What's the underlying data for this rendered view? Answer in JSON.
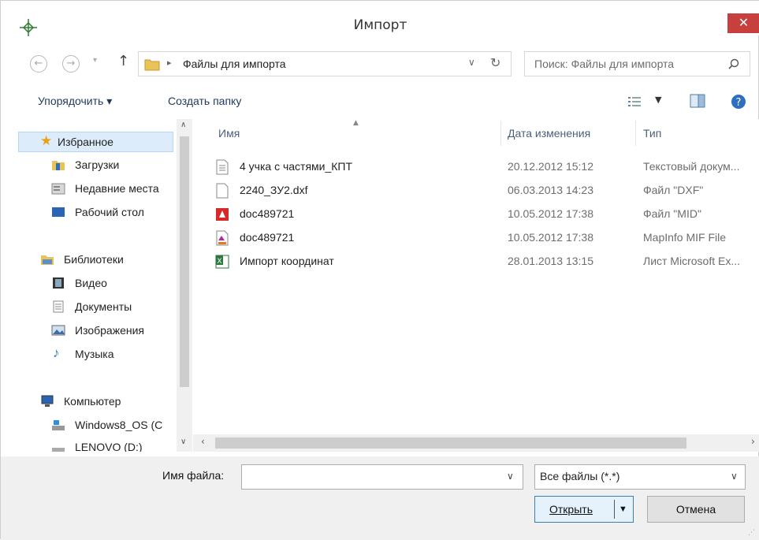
{
  "window": {
    "title": "Импорт",
    "close_glyph": "✕"
  },
  "address": {
    "separator": "▸",
    "folder": "Файлы для импорта"
  },
  "search": {
    "placeholder": "Поиск: Файлы для импорта"
  },
  "toolbar": {
    "organize": "Упорядочить ▾",
    "new_folder": "Создать папку"
  },
  "columns": {
    "name": "Имя",
    "date": "Дата изменения",
    "type": "Тип"
  },
  "sidebar": {
    "items": [
      {
        "label": "Избранное",
        "icon": "star-icon",
        "group": true
      },
      {
        "label": "Загрузки",
        "icon": "downloads-folder-icon"
      },
      {
        "label": "Недавние места",
        "icon": "recent-places-icon"
      },
      {
        "label": "Рабочий стол",
        "icon": "desktop-icon"
      },
      {
        "label": "Библиотеки",
        "icon": "libraries-icon",
        "group": true
      },
      {
        "label": "Видео",
        "icon": "video-icon"
      },
      {
        "label": "Документы",
        "icon": "documents-icon"
      },
      {
        "label": "Изображения",
        "icon": "pictures-icon"
      },
      {
        "label": "Музыка",
        "icon": "music-icon"
      },
      {
        "label": "Компьютер",
        "icon": "computer-icon",
        "group": true
      },
      {
        "label": "Windows8_OS (C",
        "icon": "drive-c-icon"
      },
      {
        "label": "LENOVO (D:)",
        "icon": "drive-d-icon"
      }
    ]
  },
  "files": [
    {
      "name": "4 учка с частями_КПТ",
      "date": "20.12.2012 15:12",
      "type": "Текстовый докум...",
      "icon": "text-file-icon"
    },
    {
      "name": "2240_ЗУ2.dxf",
      "date": "06.03.2013 14:23",
      "type": "Файл \"DXF\"",
      "icon": "blank-file-icon"
    },
    {
      "name": "doc489721",
      "date": "10.05.2012 17:38",
      "type": "Файл \"MID\"",
      "icon": "mid-file-icon"
    },
    {
      "name": "doc489721",
      "date": "10.05.2012 17:38",
      "type": "MapInfo MIF File",
      "icon": "mif-file-icon"
    },
    {
      "name": "Импорт координат",
      "date": "28.01.2013 13:15",
      "type": "Лист Microsoft Ex...",
      "icon": "excel-file-icon"
    }
  ],
  "footer": {
    "filename_label": "Имя файла:",
    "filename_value": "",
    "filter_value": "Все файлы (*.*)",
    "open_label": "Открыть",
    "cancel_label": "Отмена"
  }
}
